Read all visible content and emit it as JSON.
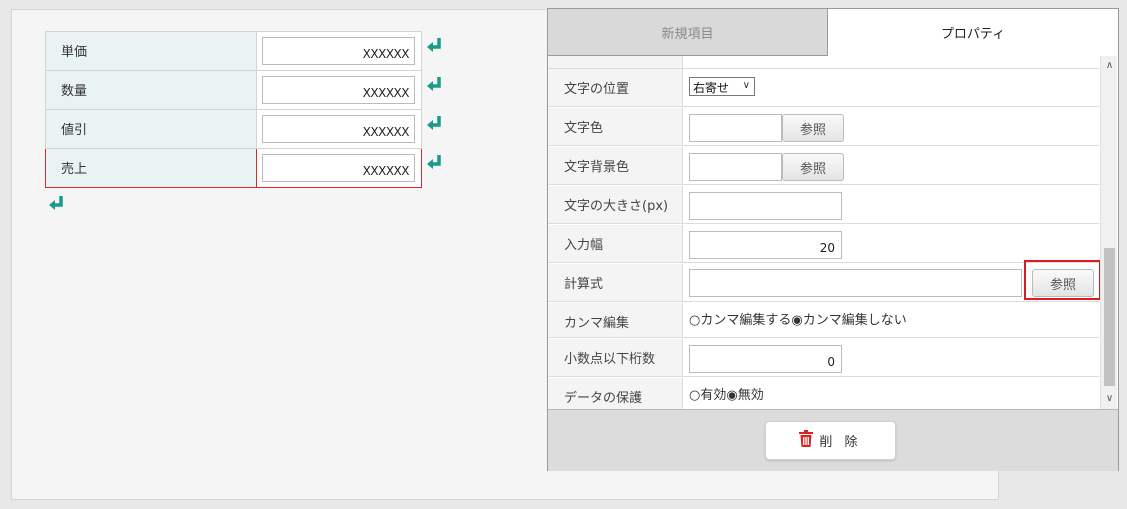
{
  "form": {
    "rows": [
      {
        "label": "単価",
        "value": "XXXXXX"
      },
      {
        "label": "数量",
        "value": "XXXXXX"
      },
      {
        "label": "値引",
        "value": "XXXXXX"
      },
      {
        "label": "売上",
        "value": "XXXXXX"
      }
    ],
    "enter_icon": "enter-arrow-icon",
    "accent_color": "#1a9a8a"
  },
  "panel": {
    "tabs": {
      "new_item": "新規項目",
      "properties": "プロパティ"
    },
    "rows": {
      "text_position": {
        "label": "文字の位置",
        "selected": "右寄せ"
      },
      "text_color": {
        "label": "文字色",
        "button": "参照"
      },
      "bg_color": {
        "label": "文字背景色",
        "button": "参照"
      },
      "font_size": {
        "label": "文字の大きさ(px)",
        "value": ""
      },
      "input_width": {
        "label": "入力幅",
        "value": "20"
      },
      "formula": {
        "label": "計算式",
        "value": "",
        "button": "参照"
      },
      "comma": {
        "label": "カンマ編集",
        "option_on": "カンマ編集する",
        "option_off": "カンマ編集しない",
        "selected": "カンマ編集しない"
      },
      "decimals": {
        "label": "小数点以下桁数",
        "value": "0"
      },
      "protect": {
        "label": "データの保護",
        "option_on": "有効",
        "option_off": "無効",
        "selected": "無効"
      }
    },
    "delete_button": "削 除",
    "delete_icon": "trash-icon",
    "highlight_color": "#d81e1e"
  }
}
